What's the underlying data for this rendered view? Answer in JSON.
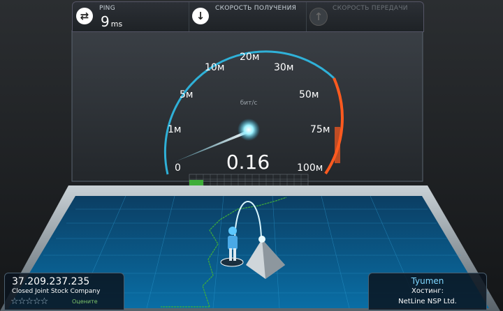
{
  "header": {
    "ping": {
      "label": "PING",
      "value": "9",
      "unit": "ms",
      "icon": "ping-icon"
    },
    "download": {
      "label": "СКОРОСТЬ ПОЛУЧЕНИЯ",
      "icon": "download-arrow-icon"
    },
    "upload": {
      "label": "СКОРОСТЬ ПЕРЕДАЧИ",
      "icon": "upload-arrow-icon"
    }
  },
  "gauge": {
    "ticks": [
      "0",
      "1м",
      "5м",
      "10м",
      "20м",
      "30м",
      "50м",
      "75м",
      "100м"
    ],
    "unit_label": "бит/с",
    "value": "0.16",
    "needle_fraction": 0.1
  },
  "client": {
    "ip": "37.209.237.235",
    "isp": "Closed Joint Stock Company",
    "stars": "☆☆☆☆☆",
    "rate_label": "Оцените"
  },
  "server": {
    "city": "Tyumen",
    "hosting_label": "Хостинг:",
    "host": "NetLine NSP Ltd."
  },
  "colors": {
    "accent": "#2fb7e0",
    "warn": "#ff5a1f",
    "progress": "#3fae3a"
  }
}
